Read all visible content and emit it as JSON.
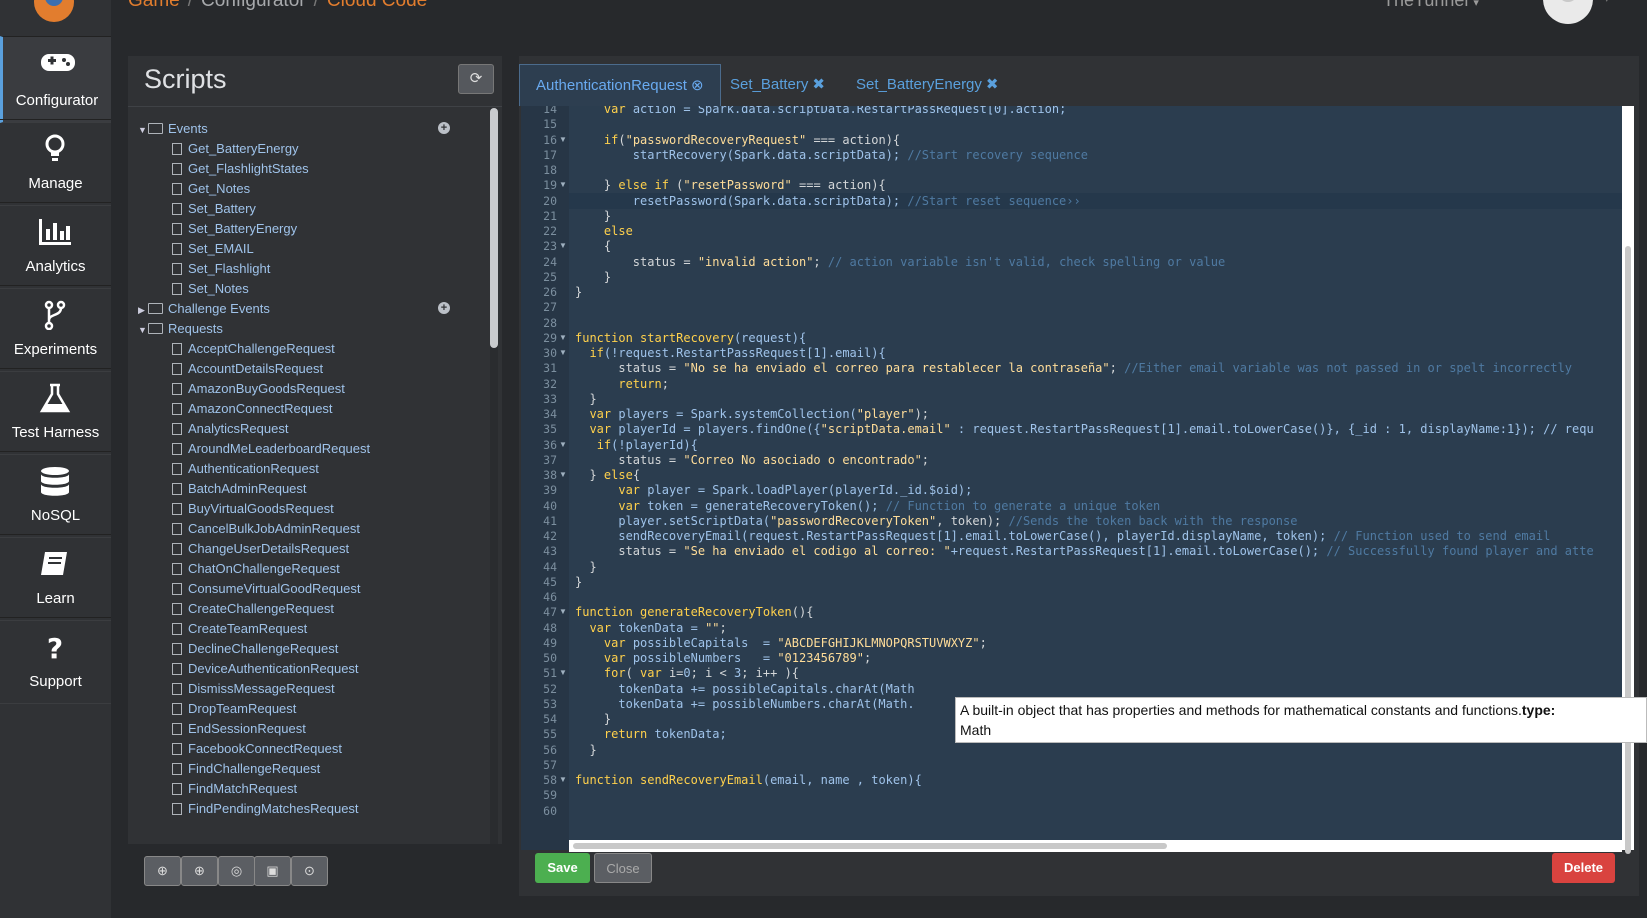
{
  "breadcrumb": {
    "items": [
      "Game",
      "Configurator",
      "Cloud Code"
    ],
    "sep": "/"
  },
  "user": {
    "name": "TheTunnel",
    "caret": "▾"
  },
  "nav": {
    "items": [
      {
        "label": "Configurator",
        "icon": "gamepad-icon",
        "active": true
      },
      {
        "label": "Manage",
        "icon": "lightbulb-icon"
      },
      {
        "label": "Analytics",
        "icon": "bar-chart-icon"
      },
      {
        "label": "Experiments",
        "icon": "fork-icon"
      },
      {
        "label": "Test Harness",
        "icon": "flask-icon"
      },
      {
        "label": "NoSQL",
        "icon": "database-icon"
      },
      {
        "label": "Learn",
        "icon": "book-icon"
      },
      {
        "label": "Support",
        "icon": "question-icon"
      }
    ]
  },
  "scripts": {
    "title": "Scripts",
    "refresh_glyph": "⟳",
    "tree": [
      {
        "label": "Events",
        "type": "folder",
        "open": true,
        "plus": true
      },
      {
        "label": "Get_BatteryEnergy",
        "type": "script"
      },
      {
        "label": "Get_FlashlightStates",
        "type": "script"
      },
      {
        "label": "Get_Notes",
        "type": "script"
      },
      {
        "label": "Set_Battery",
        "type": "script"
      },
      {
        "label": "Set_BatteryEnergy",
        "type": "script"
      },
      {
        "label": "Set_EMAIL",
        "type": "script"
      },
      {
        "label": "Set_Flashlight",
        "type": "script"
      },
      {
        "label": "Set_Notes",
        "type": "script"
      },
      {
        "label": "Challenge Events",
        "type": "folder",
        "open": false,
        "plus": true
      },
      {
        "label": "Requests",
        "type": "folder",
        "open": true
      },
      {
        "label": "AcceptChallengeRequest",
        "type": "file"
      },
      {
        "label": "AccountDetailsRequest",
        "type": "file"
      },
      {
        "label": "AmazonBuyGoodsRequest",
        "type": "file"
      },
      {
        "label": "AmazonConnectRequest",
        "type": "file"
      },
      {
        "label": "AnalyticsRequest",
        "type": "file"
      },
      {
        "label": "AroundMeLeaderboardRequest",
        "type": "file"
      },
      {
        "label": "AuthenticationRequest",
        "type": "script"
      },
      {
        "label": "BatchAdminRequest",
        "type": "file"
      },
      {
        "label": "BuyVirtualGoodsRequest",
        "type": "file"
      },
      {
        "label": "CancelBulkJobAdminRequest",
        "type": "file"
      },
      {
        "label": "ChangeUserDetailsRequest",
        "type": "file"
      },
      {
        "label": "ChatOnChallengeRequest",
        "type": "file"
      },
      {
        "label": "ConsumeVirtualGoodRequest",
        "type": "file"
      },
      {
        "label": "CreateChallengeRequest",
        "type": "file"
      },
      {
        "label": "CreateTeamRequest",
        "type": "file"
      },
      {
        "label": "DeclineChallengeRequest",
        "type": "file"
      },
      {
        "label": "DeviceAuthenticationRequest",
        "type": "file"
      },
      {
        "label": "DismissMessageRequest",
        "type": "file"
      },
      {
        "label": "DropTeamRequest",
        "type": "file"
      },
      {
        "label": "EndSessionRequest",
        "type": "file"
      },
      {
        "label": "FacebookConnectRequest",
        "type": "file"
      },
      {
        "label": "FindChallengeRequest",
        "type": "file"
      },
      {
        "label": "FindMatchRequest",
        "type": "file"
      },
      {
        "label": "FindPendingMatchesRequest",
        "type": "file"
      }
    ],
    "bottom_buttons": [
      "⊕",
      "⊕",
      "◎",
      "▣",
      "⊙"
    ]
  },
  "editor": {
    "tabs": [
      {
        "label": "AuthenticationRequest",
        "close": "⊗",
        "active": true
      },
      {
        "label": "Set_Battery",
        "close": "✖"
      },
      {
        "label": "Set_BatteryEnergy",
        "close": "✖"
      }
    ],
    "active_line": 20,
    "lines": [
      {
        "n": 14,
        "t": [
          [
            "    ",
            ""
          ],
          [
            "var ",
            "k"
          ],
          [
            "action = Spark.data.scriptData.RestartPassRequest[0].action;",
            "v"
          ]
        ]
      },
      {
        "n": 15,
        "t": []
      },
      {
        "n": 16,
        "fold": true,
        "t": [
          [
            "    ",
            ""
          ],
          [
            "if",
            "k"
          ],
          [
            "(",
            ""
          ],
          [
            "\"passwordRecoveryRequest\"",
            "s"
          ],
          [
            " === action){",
            ""
          ]
        ]
      },
      {
        "n": 17,
        "t": [
          [
            "        ",
            ""
          ],
          [
            "startRecovery(Spark.data.scriptData); ",
            "v"
          ],
          [
            "//Start recovery sequence",
            "c"
          ]
        ]
      },
      {
        "n": 18,
        "t": []
      },
      {
        "n": 19,
        "fold": true,
        "t": [
          [
            "    } ",
            ""
          ],
          [
            "else if ",
            "k"
          ],
          [
            "(",
            ""
          ],
          [
            "\"resetPassword\"",
            "s"
          ],
          [
            " === action){",
            ""
          ]
        ]
      },
      {
        "n": 20,
        "t": [
          [
            "        ",
            ""
          ],
          [
            "resetPassword(Spark.data.scriptData); ",
            "v"
          ],
          [
            "//Start reset sequence››",
            "c"
          ]
        ]
      },
      {
        "n": 21,
        "t": [
          [
            "    }",
            ""
          ]
        ]
      },
      {
        "n": 22,
        "t": [
          [
            "    ",
            ""
          ],
          [
            "else",
            "k"
          ]
        ]
      },
      {
        "n": 23,
        "fold": true,
        "t": [
          [
            "    {",
            ""
          ]
        ]
      },
      {
        "n": 24,
        "t": [
          [
            "        status = ",
            ""
          ],
          [
            "\"invalid action\"",
            "s"
          ],
          [
            "; ",
            ""
          ],
          [
            "// action variable isn't valid, check spelling or value",
            "c"
          ]
        ]
      },
      {
        "n": 25,
        "t": [
          [
            "    }",
            ""
          ]
        ]
      },
      {
        "n": 26,
        "t": [
          [
            "}",
            ""
          ]
        ]
      },
      {
        "n": 27,
        "t": []
      },
      {
        "n": 28,
        "t": []
      },
      {
        "n": 29,
        "fold": true,
        "t": [
          [
            "function ",
            "k"
          ],
          [
            "startRecovery",
            "f"
          ],
          [
            "(request){",
            "v"
          ]
        ]
      },
      {
        "n": 30,
        "fold": true,
        "t": [
          [
            "  ",
            ""
          ],
          [
            "if",
            "k"
          ],
          [
            "(!request.RestartPassRequest[1].email){",
            "v"
          ]
        ]
      },
      {
        "n": 31,
        "t": [
          [
            "      status = ",
            ""
          ],
          [
            "\"No se ha enviado el correo para restablecer la contraseña\"",
            "s"
          ],
          [
            "; ",
            ""
          ],
          [
            "//Either email variable was not passed in or spelt incorrectly",
            "c"
          ]
        ]
      },
      {
        "n": 32,
        "t": [
          [
            "      ",
            ""
          ],
          [
            "return",
            "k"
          ],
          [
            ";",
            ""
          ]
        ]
      },
      {
        "n": 33,
        "t": [
          [
            "  }",
            ""
          ]
        ]
      },
      {
        "n": 34,
        "t": [
          [
            "  ",
            ""
          ],
          [
            "var ",
            "k"
          ],
          [
            "players = Spark.systemCollection(",
            "v"
          ],
          [
            "\"player\"",
            "s"
          ],
          [
            ");",
            ""
          ]
        ]
      },
      {
        "n": 35,
        "t": [
          [
            "  ",
            ""
          ],
          [
            "var ",
            "k"
          ],
          [
            "playerId = players.findOne({",
            "v"
          ],
          [
            "\"scriptData.email\"",
            "s"
          ],
          [
            " : request.RestartPassRequest[1].email.toLowerCase()}, {_id : 1, displayName:1}); // requ",
            "v"
          ]
        ]
      },
      {
        "n": 36,
        "fold": true,
        "t": [
          [
            "   ",
            ""
          ],
          [
            "if",
            "k"
          ],
          [
            "(!playerId){",
            "v"
          ]
        ]
      },
      {
        "n": 37,
        "t": [
          [
            "      status = ",
            ""
          ],
          [
            "\"Correo No asociado o encontrado\"",
            "s"
          ],
          [
            ";",
            ""
          ]
        ]
      },
      {
        "n": 38,
        "fold": true,
        "t": [
          [
            "  } ",
            ""
          ],
          [
            "else",
            "k"
          ],
          [
            "{",
            ""
          ]
        ]
      },
      {
        "n": 39,
        "t": [
          [
            "      ",
            ""
          ],
          [
            "var ",
            "k"
          ],
          [
            "player = Spark.loadPlayer(playerId._id.$oid);",
            "v"
          ]
        ]
      },
      {
        "n": 40,
        "t": [
          [
            "      ",
            ""
          ],
          [
            "var ",
            "k"
          ],
          [
            "token = generateRecoveryToken(); ",
            "v"
          ],
          [
            "// Function to generate a unique token",
            "c"
          ]
        ]
      },
      {
        "n": 41,
        "t": [
          [
            "      player.setScriptData(",
            "v"
          ],
          [
            "\"passwordRecoveryToken\"",
            "s"
          ],
          [
            ", token); ",
            ""
          ],
          [
            "//Sends the token back with the response",
            "c"
          ]
        ]
      },
      {
        "n": 42,
        "t": [
          [
            "      sendRecoveryEmail(request.RestartPassRequest[1].email.toLowerCase(), playerId.displayName, token); ",
            "v"
          ],
          [
            "// Function used to send email",
            "c"
          ]
        ]
      },
      {
        "n": 43,
        "t": [
          [
            "      status = ",
            ""
          ],
          [
            "\"Se ha enviado el codigo al correo: \"",
            "s"
          ],
          [
            "+request.RestartPassRequest[1].email.toLowerCase(); ",
            "v"
          ],
          [
            "// Successfully found player and atte",
            "c"
          ]
        ]
      },
      {
        "n": 44,
        "t": [
          [
            "  }",
            ""
          ]
        ]
      },
      {
        "n": 45,
        "t": [
          [
            "}",
            ""
          ]
        ]
      },
      {
        "n": 46,
        "t": []
      },
      {
        "n": 47,
        "fold": true,
        "t": [
          [
            "function ",
            "k"
          ],
          [
            "generateRecoveryToken",
            "f"
          ],
          [
            "(){",
            ""
          ]
        ]
      },
      {
        "n": 48,
        "t": [
          [
            "  ",
            ""
          ],
          [
            "var ",
            "k"
          ],
          [
            "tokenData = ",
            "v"
          ],
          [
            "\"\"",
            "s"
          ],
          [
            ";",
            ""
          ]
        ]
      },
      {
        "n": 49,
        "t": [
          [
            "    ",
            ""
          ],
          [
            "var ",
            "k"
          ],
          [
            "possibleCapitals  = ",
            "v"
          ],
          [
            "\"ABCDEFGHIJKLMNOPQRSTUVWXYZ\"",
            "s"
          ],
          [
            ";",
            ""
          ]
        ]
      },
      {
        "n": 50,
        "t": [
          [
            "    ",
            ""
          ],
          [
            "var ",
            "k"
          ],
          [
            "possibleNumbers   = ",
            "v"
          ],
          [
            "\"0123456789\"",
            "s"
          ],
          [
            ";",
            ""
          ]
        ]
      },
      {
        "n": 51,
        "fold": true,
        "t": [
          [
            "    ",
            ""
          ],
          [
            "for",
            "k"
          ],
          [
            "( ",
            ""
          ],
          [
            "var ",
            "k"
          ],
          [
            "i=",
            ""
          ],
          [
            "0",
            "n"
          ],
          [
            "; i < ",
            ""
          ],
          [
            "3",
            "n"
          ],
          [
            "; i++ ){",
            ""
          ]
        ]
      },
      {
        "n": 52,
        "t": [
          [
            "      tokenData += possibleCapitals.charAt(Math",
            "v"
          ]
        ]
      },
      {
        "n": 53,
        "t": [
          [
            "      tokenData += possibleNumbers.charAt(Math.",
            "v"
          ]
        ]
      },
      {
        "n": 54,
        "t": [
          [
            "    }",
            ""
          ]
        ]
      },
      {
        "n": 55,
        "t": [
          [
            "    ",
            ""
          ],
          [
            "return ",
            "k"
          ],
          [
            "tokenData;",
            "v"
          ]
        ]
      },
      {
        "n": 56,
        "t": [
          [
            "  }",
            ""
          ]
        ]
      },
      {
        "n": 57,
        "t": []
      },
      {
        "n": 58,
        "fold": true,
        "t": [
          [
            "function ",
            "k"
          ],
          [
            "sendRecoveryEmail",
            "f"
          ],
          [
            "(email, name , token){",
            "v"
          ]
        ]
      },
      {
        "n": 59,
        "t": []
      },
      {
        "n": 60,
        "t": []
      }
    ],
    "tooltip": {
      "text": "A built-in object that has properties and methods for mathematical constants and functions.",
      "bold": "type:",
      "type": "Math"
    },
    "save_label": "Save",
    "close_label": "Close",
    "delete_label": "Delete"
  },
  "colors": {
    "accent": "#e27d2e",
    "link": "#5aa0dd",
    "save": "#4caf50",
    "delete": "#d9433f"
  }
}
